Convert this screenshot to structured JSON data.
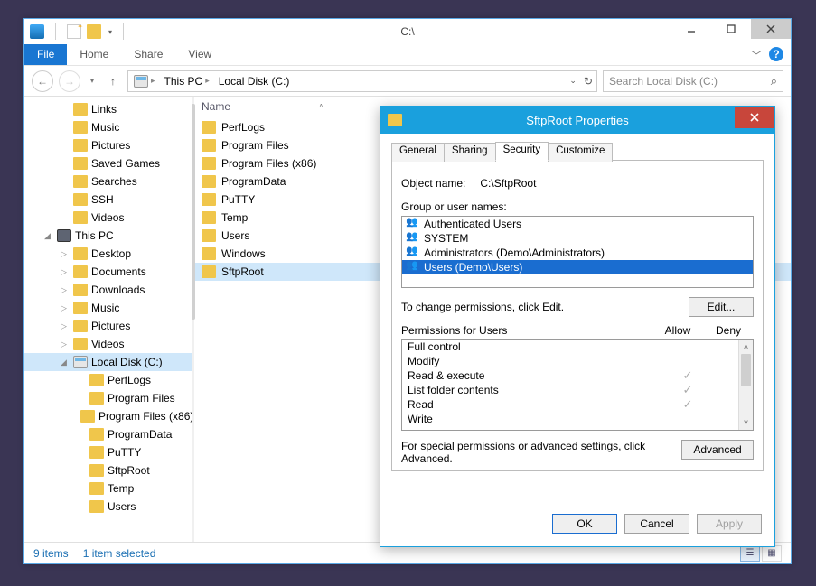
{
  "titlebar": {
    "path_title": "C:\\"
  },
  "ribbon": {
    "tabs": [
      "File",
      "Home",
      "Share",
      "View"
    ]
  },
  "toolbar": {
    "breadcrumbs": [
      "This PC",
      "Local Disk (C:)"
    ],
    "search_placeholder": "Search Local Disk (C:)"
  },
  "nav_tree": {
    "favorites": [
      "Links",
      "Music",
      "Pictures",
      "Saved Games",
      "Searches",
      "SSH",
      "Videos"
    ],
    "pc_label": "This PC",
    "pc_children": [
      "Desktop",
      "Documents",
      "Downloads",
      "Music",
      "Pictures",
      "Videos"
    ],
    "drive_label": "Local Disk (C:)",
    "drive_children": [
      "PerfLogs",
      "Program Files",
      "Program Files (x86)",
      "ProgramData",
      "PuTTY",
      "SftpRoot",
      "Temp",
      "Users"
    ]
  },
  "columns": {
    "name": "Name"
  },
  "files": [
    "PerfLogs",
    "Program Files",
    "Program Files (x86)",
    "ProgramData",
    "PuTTY",
    "Temp",
    "Users",
    "Windows",
    "SftpRoot"
  ],
  "files_selected_index": 8,
  "status": {
    "items": "9 items",
    "selected": "1 item selected"
  },
  "dialog": {
    "title": "SftpRoot Properties",
    "tabs": [
      "General",
      "Sharing",
      "Security",
      "Customize"
    ],
    "active_tab": 2,
    "object_name_label": "Object name:",
    "object_name_value": "C:\\SftpRoot",
    "group_label": "Group or user names:",
    "groups": [
      "Authenticated Users",
      "SYSTEM",
      "Administrators (Demo\\Administrators)",
      "Users (Demo\\Users)"
    ],
    "groups_selected_index": 3,
    "edit_hint": "To change permissions, click Edit.",
    "edit_button": "Edit...",
    "perm_label": "Permissions for Users",
    "perm_allow": "Allow",
    "perm_deny": "Deny",
    "permissions": [
      {
        "name": "Full control",
        "allow": false,
        "deny": false
      },
      {
        "name": "Modify",
        "allow": false,
        "deny": false
      },
      {
        "name": "Read & execute",
        "allow": true,
        "deny": false
      },
      {
        "name": "List folder contents",
        "allow": true,
        "deny": false
      },
      {
        "name": "Read",
        "allow": true,
        "deny": false
      },
      {
        "name": "Write",
        "allow": false,
        "deny": false
      }
    ],
    "advanced_text": "For special permissions or advanced settings, click Advanced.",
    "advanced_button": "Advanced",
    "ok": "OK",
    "cancel": "Cancel",
    "apply": "Apply"
  }
}
